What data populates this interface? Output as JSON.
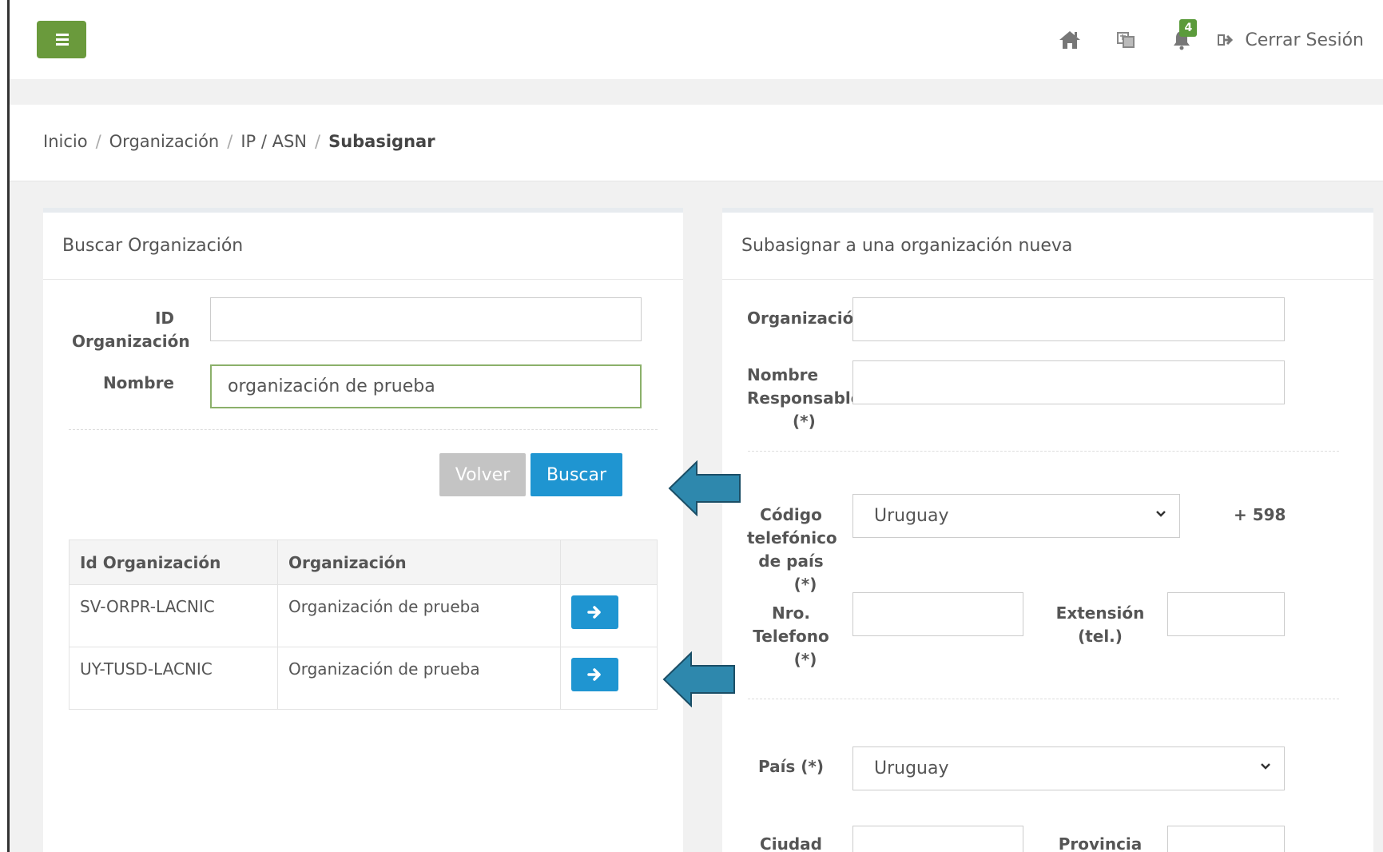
{
  "topbar": {
    "menu_icon": "hamburger-icon",
    "notification_count": "4",
    "logout_label": "Cerrar Sesión",
    "icons": [
      "home-icon",
      "translate-icon",
      "bell-icon",
      "logout-icon"
    ],
    "brand_color": "#6a9a3c"
  },
  "breadcrumb": {
    "items": [
      "Inicio",
      "Organización",
      "IP / ASN"
    ],
    "current": "Subasignar"
  },
  "search_panel": {
    "title": "Buscar Organización",
    "id_label_line1": "ID",
    "id_label_line2": "Organización",
    "id_value": "",
    "name_label": "Nombre",
    "name_value": "organización de prueba",
    "back_label": "Volver",
    "search_label": "Buscar",
    "table": {
      "headers": [
        "Id Organización",
        "Organización",
        ""
      ],
      "rows": [
        {
          "id": "SV-ORPR-LACNIC",
          "name": "Organización de prueba"
        },
        {
          "id": "UY-TUSD-LACNIC",
          "name": "Organización de prueba"
        }
      ]
    }
  },
  "new_panel": {
    "title": "Subasignar a una organización nueva",
    "org_label": "Organización",
    "org_value": "",
    "resp_label_1": "Nombre",
    "resp_label_2": "Responsable",
    "resp_label_3": "(*)",
    "resp_value": "",
    "code_label_1": "Código",
    "code_label_2": "telefónico",
    "code_label_3": "de país",
    "code_label_4": "(*)",
    "code_value": "Uruguay",
    "code_prefix": "+ 598",
    "phone_label_1": "Nro.",
    "phone_label_2": "Telefono",
    "phone_label_3": "(*)",
    "phone_value": "",
    "ext_label_1": "Extensión",
    "ext_label_2": "(tel.)",
    "ext_value": "",
    "country_label": "País (*)",
    "country_value": "Uruguay",
    "city_label": "Ciudad",
    "province_label": "Provincia"
  },
  "colors": {
    "accent_blue": "#1f95d1",
    "annotation_arrow": "#2e88ad"
  }
}
